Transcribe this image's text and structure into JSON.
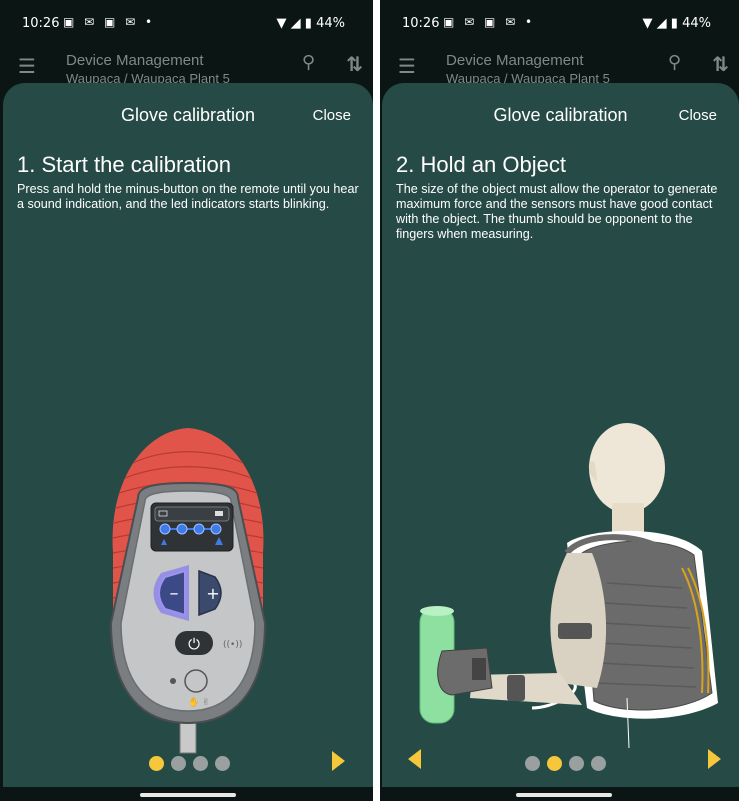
{
  "status": {
    "time": "10:26",
    "battery": "44%",
    "notif_icons": "teams-icon gmail-icon outlook-icon gmail-icon"
  },
  "appbar": {
    "title": "Device Management",
    "breadcrumb": "Waupaca  / Waupaca Plant 5"
  },
  "sheet": {
    "title": "Glove calibration",
    "close_label": "Close"
  },
  "steps": [
    {
      "title": "1. Start the calibration",
      "description": "Press and hold the minus-button on the remote until you hear a sound indication, and the led indicators starts blinking.",
      "dots_active": 0
    },
    {
      "title": "2. Hold an Object",
      "description": "The size of the object must allow the operator to generate maximum force and the sensors must have good contact with the object. The thumb should be opponent to the fingers when measuring.",
      "dots_active": 1
    }
  ],
  "colors": {
    "sheet_bg": "#264a46",
    "accent": "#f6c73a",
    "dot_inactive": "#9aa0a0",
    "remote_red": "#e0544a",
    "led_blue": "#3f7be6"
  }
}
